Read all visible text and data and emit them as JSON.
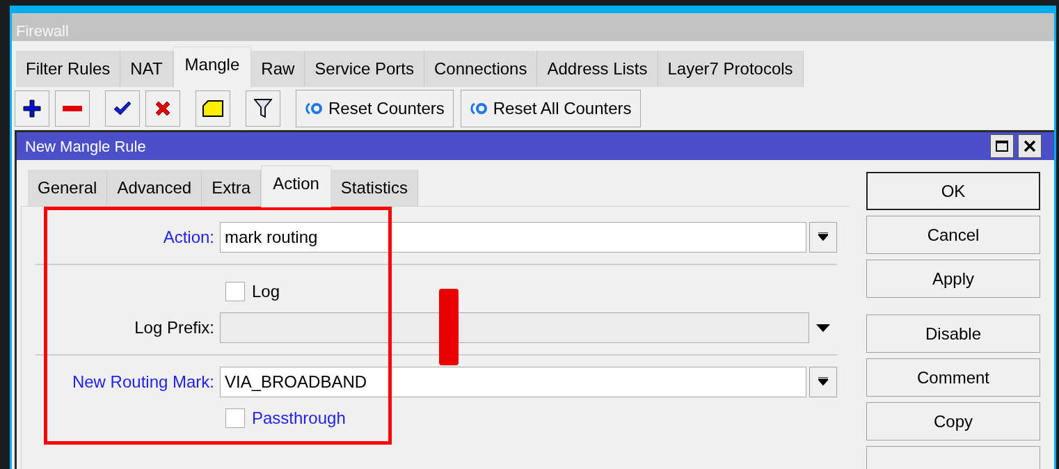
{
  "window": {
    "title": "Firewall"
  },
  "tabs": [
    {
      "label": "Filter Rules",
      "selected": false
    },
    {
      "label": "NAT",
      "selected": false
    },
    {
      "label": "Mangle",
      "selected": true
    },
    {
      "label": "Raw",
      "selected": false
    },
    {
      "label": "Service Ports",
      "selected": false
    },
    {
      "label": "Connections",
      "selected": false
    },
    {
      "label": "Address Lists",
      "selected": false
    },
    {
      "label": "Layer7 Protocols",
      "selected": false
    }
  ],
  "toolbar": [
    {
      "kind": "add"
    },
    {
      "kind": "remove"
    },
    {
      "kind": "enable"
    },
    {
      "kind": "disable"
    },
    {
      "kind": "comment"
    },
    {
      "kind": "filter"
    },
    {
      "kind": "reset",
      "label": "Reset Counters"
    },
    {
      "kind": "reset",
      "label": "Reset All Counters"
    }
  ],
  "dialog": {
    "title": "New Mangle Rule",
    "tabs": [
      {
        "label": "General",
        "selected": false
      },
      {
        "label": "Advanced",
        "selected": false
      },
      {
        "label": "Extra",
        "selected": false
      },
      {
        "label": "Action",
        "selected": true
      },
      {
        "label": "Statistics",
        "selected": false
      }
    ],
    "form": [
      {
        "kind": "select",
        "label": "Action:",
        "value": "mark routing",
        "modified": true
      },
      {
        "kind": "separator"
      },
      {
        "kind": "checkbox",
        "label": "Log",
        "checked": false,
        "modified": false
      },
      {
        "kind": "text",
        "label": "Log Prefix:",
        "disabled": true,
        "modified": false
      },
      {
        "kind": "separator"
      },
      {
        "kind": "select",
        "label": "New Routing Mark:",
        "value": "VIA_BROADBAND",
        "modified": true
      },
      {
        "kind": "checkbox",
        "label": "Passthrough",
        "checked": false,
        "modified": true
      }
    ],
    "buttons": [
      {
        "kind": "button",
        "label": "OK",
        "default": true
      },
      {
        "kind": "button",
        "label": "Cancel",
        "default": false
      },
      {
        "kind": "button",
        "label": "Apply",
        "default": false
      },
      {
        "kind": "spacer"
      },
      {
        "kind": "button",
        "label": "Disable",
        "default": false
      },
      {
        "kind": "button",
        "label": "Comment",
        "default": false
      },
      {
        "kind": "button",
        "label": "Copy",
        "default": false
      }
    ]
  },
  "annotations": {
    "box": true,
    "stroke": true
  }
}
